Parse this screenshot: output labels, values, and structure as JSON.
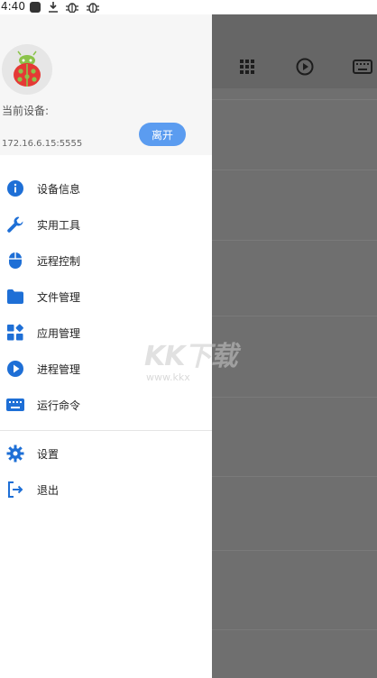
{
  "status_bar": {
    "time": "4:40"
  },
  "drawer": {
    "device_label": "当前设备:",
    "device_ip": "172.16.6.15:5555",
    "leave_button": "离开",
    "menu_items": [
      {
        "label": "设备信息",
        "icon": "info-icon"
      },
      {
        "label": "实用工具",
        "icon": "wrench-icon"
      },
      {
        "label": "远程控制",
        "icon": "mouse-icon"
      },
      {
        "label": "文件管理",
        "icon": "folder-icon"
      },
      {
        "label": "应用管理",
        "icon": "apps-icon"
      },
      {
        "label": "进程管理",
        "icon": "play-circle-icon"
      },
      {
        "label": "运行命令",
        "icon": "keyboard-icon"
      }
    ],
    "bottom_items": [
      {
        "label": "设置",
        "icon": "gear-icon"
      },
      {
        "label": "退出",
        "icon": "exit-icon"
      }
    ]
  },
  "colors": {
    "accent": "#1e6fd6",
    "button": "#5b9cf0",
    "scrim": "#6f6f6f"
  },
  "watermark": {
    "main": "KK下载",
    "url": "www.kkx"
  }
}
